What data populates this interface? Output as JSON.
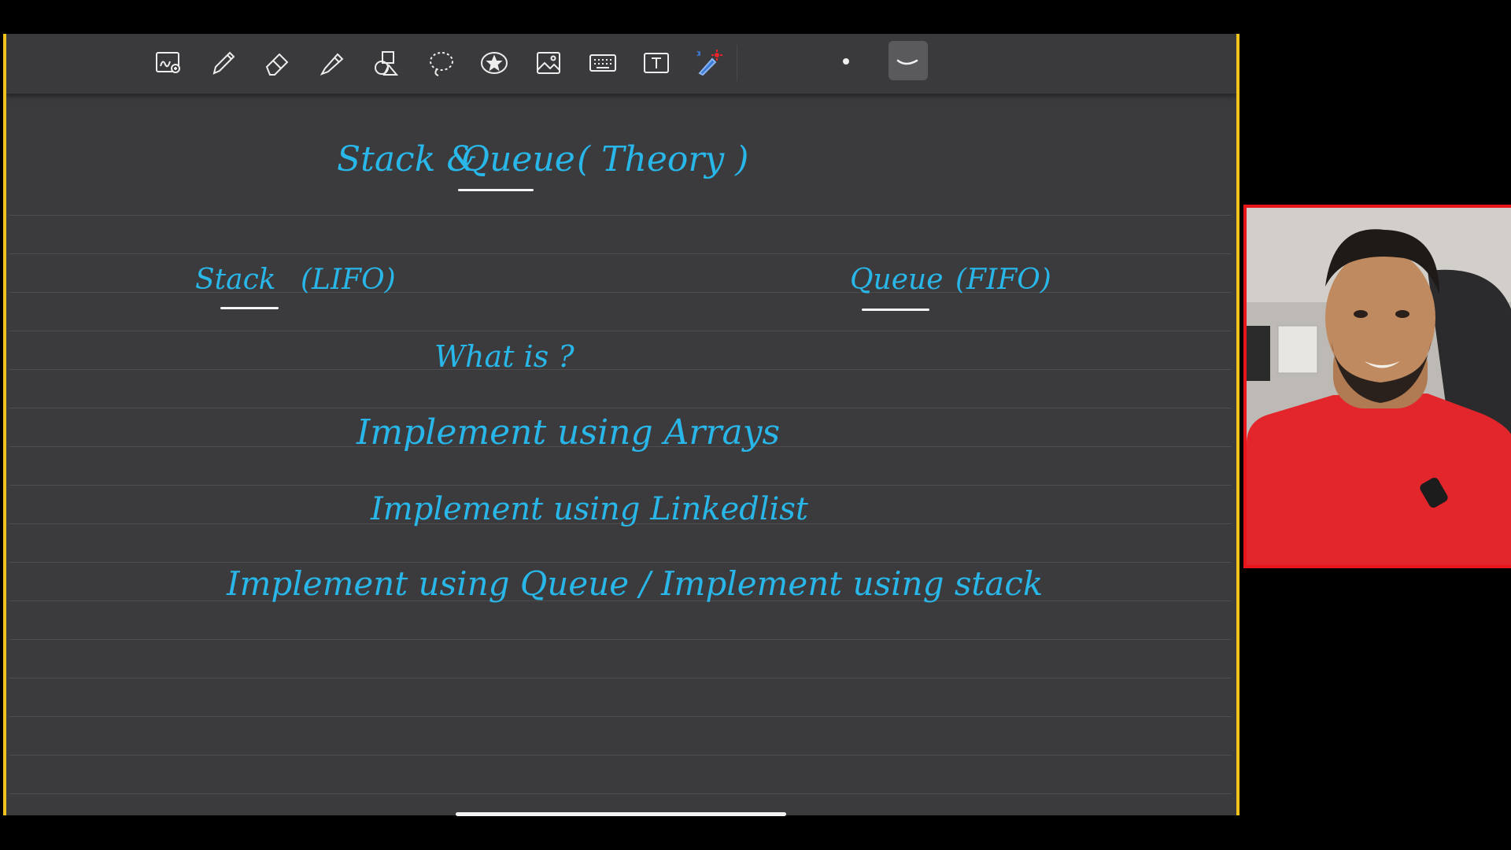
{
  "notes": {
    "title_part1": "Stack &",
    "title_part2": "Queue",
    "title_part3": "( Theory )",
    "stack_heading": "Stack",
    "stack_tag": "(LIFO)",
    "queue_heading": "Queue",
    "queue_tag": "(FIFO)",
    "line_what_is": "What is ?",
    "line_arrays": "Implement using Arrays",
    "line_linkedlist": "Implement using Linkedlist",
    "line_queue_stack": "Implement using Queue / Implement using stack"
  },
  "colors": {
    "ink": "#29b6e8",
    "paper": "#3b3b3d",
    "frame_border": "#f1c21b",
    "webcam_border": "#e8161a"
  },
  "toolbar_icons": [
    "zoom-window-icon",
    "pen-icon",
    "eraser-icon",
    "highlighter-icon",
    "shapes-icon",
    "lasso-icon",
    "sticker-icon",
    "image-icon",
    "keyboard-icon",
    "text-box-icon",
    "laser-pointer-icon"
  ]
}
